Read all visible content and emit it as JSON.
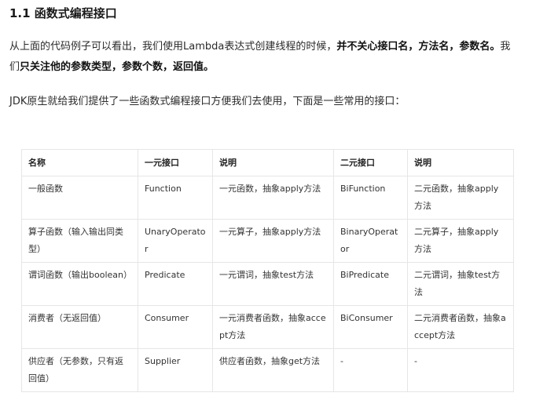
{
  "heading": "1.1 函数式编程接口",
  "para1": {
    "normal": "从上面的代码例子可以看出，我们使用Lambda表达式创建线程的时候，",
    "bold1": "并不关心接口名，方法名，参数名。",
    "middle": "我们",
    "bold2": "只关注他的参数类型，参数个数，返回值。"
  },
  "para2": "JDK原生就给我们提供了一些函数式编程接口方便我们去使用，下面是一些常用的接口：",
  "table": {
    "headers": [
      "名称",
      "一元接口",
      "说明",
      "二元接口",
      "说明"
    ],
    "rows": [
      [
        "一般函数",
        "Function",
        "一元函数，抽象apply方法",
        "BiFunction",
        "二元函数，抽象apply方法"
      ],
      [
        "算子函数（输入输出同类型）",
        "UnaryOperator",
        "一元算子，抽象apply方法",
        "BinaryOperator",
        "二元算子，抽象apply方法"
      ],
      [
        "谓词函数（输出boolean）",
        "Predicate",
        "一元谓词，抽象test方法",
        "BiPredicate",
        "二元谓词，抽象test方法"
      ],
      [
        "消费者（无返回值）",
        "Consumer",
        "一元消费者函数，抽象accept方法",
        "BiConsumer",
        "二元消费者函数，抽象accept方法"
      ],
      [
        "供应者（无参数，只有返回值）",
        "Supplier",
        "供应者函数，抽象get方法",
        "-",
        "-"
      ]
    ]
  }
}
